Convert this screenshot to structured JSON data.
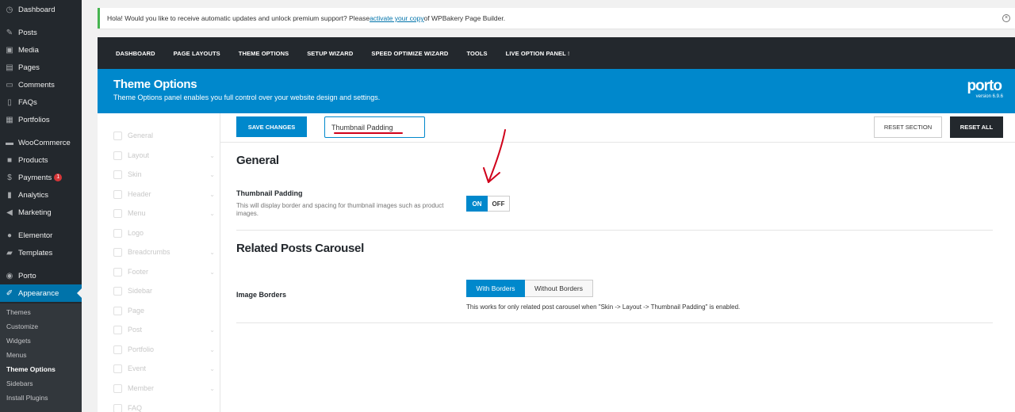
{
  "wp_menu": {
    "items": [
      {
        "label": "Dashboard",
        "icon": "dashboard-icon"
      },
      {
        "label": "Posts",
        "icon": "pin-icon"
      },
      {
        "label": "Media",
        "icon": "media-icon"
      },
      {
        "label": "Pages",
        "icon": "pages-icon"
      },
      {
        "label": "Comments",
        "icon": "comment-icon"
      },
      {
        "label": "FAQs",
        "icon": "faq-icon"
      },
      {
        "label": "Portfolios",
        "icon": "portfolio-icon"
      },
      {
        "label": "WooCommerce",
        "icon": "woocommerce-icon"
      },
      {
        "label": "Products",
        "icon": "products-icon"
      },
      {
        "label": "Payments",
        "icon": "payments-icon",
        "badge": "1"
      },
      {
        "label": "Analytics",
        "icon": "analytics-icon"
      },
      {
        "label": "Marketing",
        "icon": "megaphone-icon"
      },
      {
        "label": "Elementor",
        "icon": "elementor-icon"
      },
      {
        "label": "Templates",
        "icon": "templates-icon"
      },
      {
        "label": "Porto",
        "icon": "porto-icon"
      },
      {
        "label": "Appearance",
        "icon": "paintbrush-icon"
      }
    ],
    "submenu": [
      "Themes",
      "Customize",
      "Widgets",
      "Menus",
      "Theme Options",
      "Sidebars",
      "Install Plugins"
    ]
  },
  "notice": {
    "before_link": "Hola! Would you like to receive automatic updates and unlock premium support? Please ",
    "link": "activate your copy",
    "after_link": " of WPBakery Page Builder."
  },
  "topnav": [
    "DASHBOARD",
    "PAGE LAYOUTS",
    "THEME OPTIONS",
    "SETUP WIZARD",
    "SPEED OPTIMIZE WIZARD",
    "TOOLS",
    "LIVE OPTION PANEL"
  ],
  "header": {
    "title": "Theme Options",
    "subtitle": "Theme Options panel enables you full control over your website design and settings.",
    "logo": "porto",
    "version": "version 6.9.6"
  },
  "leftnav": [
    "General",
    "Layout",
    "Skin",
    "Header",
    "Menu",
    "Logo",
    "Breadcrumbs",
    "Footer",
    "Sidebar",
    "Page",
    "Post",
    "Portfolio",
    "Event",
    "Member",
    "FAQ"
  ],
  "toolbar": {
    "save": "SAVE CHANGES",
    "search_value": "Thumbnail Padding",
    "reset_section": "RESET SECTION",
    "reset_all": "RESET ALL"
  },
  "general": {
    "title": "General",
    "field_label": "Thumbnail Padding",
    "field_desc": "This will display border and spacing for thumbnail images such as product images.",
    "on": "ON",
    "off": "OFF",
    "value": "ON"
  },
  "related": {
    "title": "Related Posts Carousel",
    "field_label": "Image Borders",
    "options": [
      "With Borders",
      "Without Borders"
    ],
    "selected": "With Borders",
    "note": "This works for only related post carousel when \"Skin -> Layout -> Thumbnail Padding\" is enabled."
  },
  "colors": {
    "accent": "#0088cc",
    "wp_dark": "#23282d",
    "wp_active": "#0073aa",
    "annotation": "#d0021b"
  }
}
